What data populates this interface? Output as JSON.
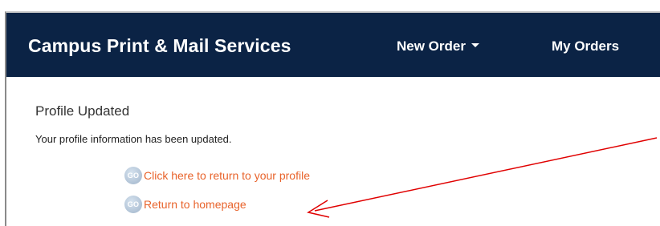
{
  "navbar": {
    "brand": "Campus Print & Mail Services",
    "items": [
      {
        "label": "New Order",
        "has_dropdown": true
      },
      {
        "label": "My Orders",
        "has_dropdown": false
      }
    ],
    "background_color": "#0b2345"
  },
  "main": {
    "heading": "Profile Updated",
    "message": "Your profile information has been updated.",
    "links": [
      {
        "icon_label": "GO",
        "text": "Click here to return to your profile"
      },
      {
        "icon_label": "GO",
        "text": "Return to homepage"
      }
    ],
    "link_color": "#e8632b"
  },
  "annotation": {
    "type": "arrow",
    "color": "#e00000",
    "points_to": "Return to homepage"
  }
}
